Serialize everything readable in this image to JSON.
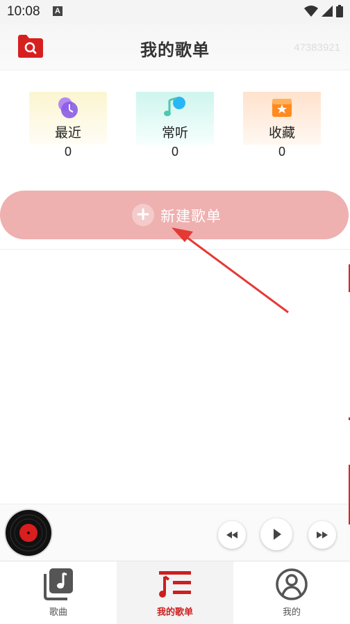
{
  "status_bar": {
    "time": "10:08",
    "notification_badge": "A"
  },
  "header": {
    "title": "我的歌单",
    "user_id": "47383921"
  },
  "categories": [
    {
      "label": "最近",
      "count": "0",
      "icon": "clock-icon"
    },
    {
      "label": "常听",
      "count": "0",
      "icon": "music-note-icon"
    },
    {
      "label": "收藏",
      "count": "0",
      "icon": "star-box-icon"
    }
  ],
  "new_playlist": {
    "label": "新建歌单"
  },
  "tabbar": [
    {
      "label": "歌曲",
      "icon": "song-library-icon"
    },
    {
      "label": "我的歌单",
      "icon": "playlist-icon",
      "active": true
    },
    {
      "label": "我的",
      "icon": "profile-icon"
    }
  ],
  "colors": {
    "accent": "#cc1f1f",
    "new_button_bg": "#efb0b0",
    "arrow": "#e53935"
  }
}
